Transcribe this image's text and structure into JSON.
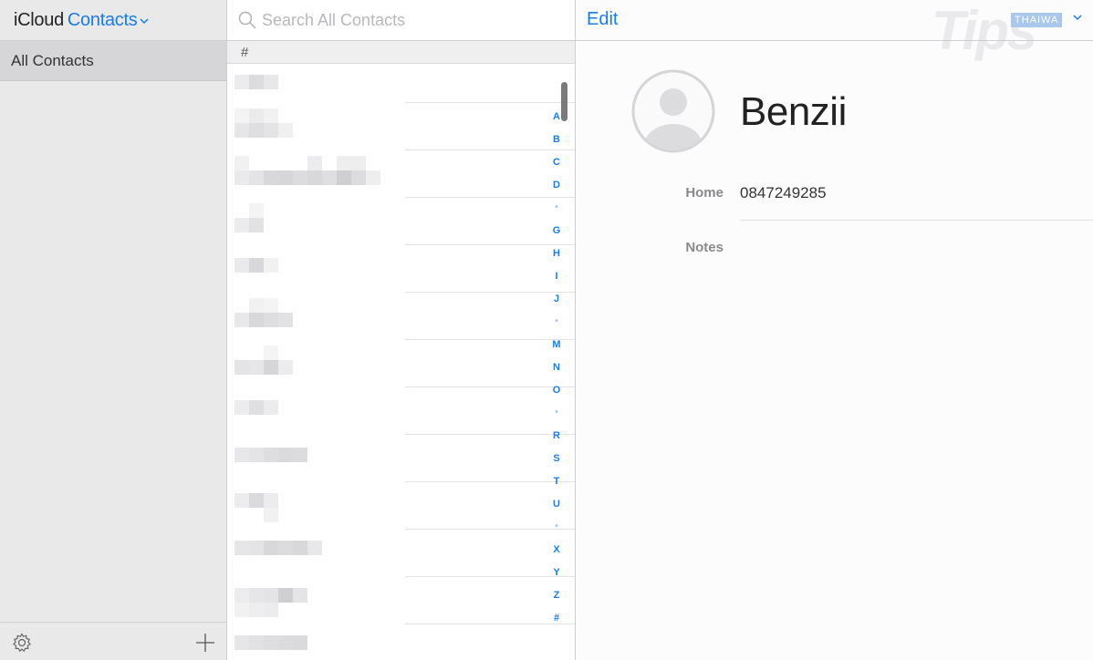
{
  "sidebar": {
    "app_name": "iCloud",
    "section_label": "Contacts",
    "groups": [
      {
        "label": "All Contacts"
      }
    ],
    "footer": {
      "settings_icon": "gear-icon",
      "add_icon": "plus-icon"
    }
  },
  "list": {
    "search_placeholder": "Search All Contacts",
    "section_header": "#",
    "index_letters": [
      "A",
      "B",
      "C",
      "D",
      "•",
      "G",
      "H",
      "I",
      "J",
      "•",
      "M",
      "N",
      "O",
      "•",
      "R",
      "S",
      "T",
      "U",
      "•",
      "X",
      "Y",
      "Z",
      "#"
    ]
  },
  "detail": {
    "edit_label": "Edit",
    "contact_name": "Benzii",
    "fields": [
      {
        "label": "Home",
        "value": "0847249285"
      },
      {
        "label": "Notes",
        "value": ""
      }
    ]
  },
  "watermark": {
    "text": "Tips",
    "badge": "THAIWA"
  },
  "colors": {
    "accent": "#1a7de0",
    "sidebar_bg": "#e9e9ea",
    "selected_group": "#d6d6d8"
  }
}
